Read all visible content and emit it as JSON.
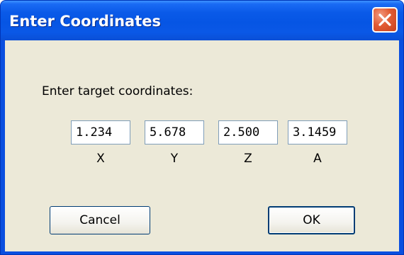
{
  "window": {
    "title": "Enter Coordinates"
  },
  "dialog": {
    "prompt": "Enter target coordinates:",
    "fields": [
      {
        "label": "X",
        "value": "1.234"
      },
      {
        "label": "Y",
        "value": "5.678"
      },
      {
        "label": "Z",
        "value": "2.500"
      },
      {
        "label": "A",
        "value": "3.1459"
      }
    ],
    "cancel_label": "Cancel",
    "ok_label": "OK"
  },
  "colors": {
    "titlebar": "#0655e4",
    "close_button": "#e25c34",
    "client_background": "#ece9d8",
    "field_border": "#7f9db9",
    "button_border": "#003c74"
  },
  "icons": {
    "close": "close-icon"
  }
}
